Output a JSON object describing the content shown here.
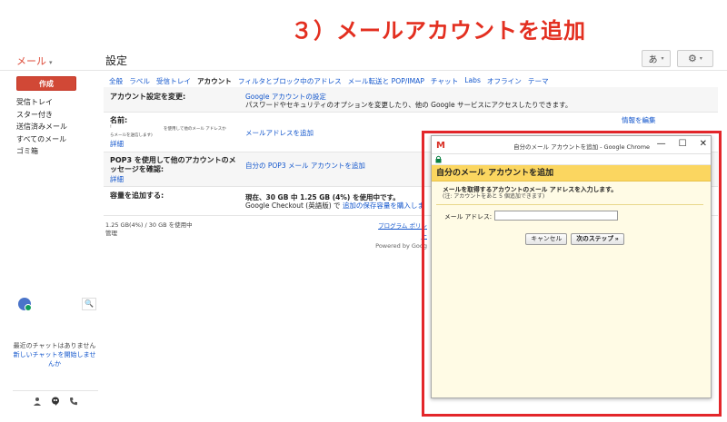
{
  "headline": "３）メールアカウントを追加",
  "topbar": {
    "mail_label": "メール",
    "mail_caret": "▾",
    "settings_title": "設定",
    "lang_button": "あ",
    "caret": "▾",
    "gear": "⚙"
  },
  "sidebar": {
    "compose": "作成",
    "items": [
      "受信トレイ",
      "スター付き",
      "送信済みメール",
      "すべてのメール",
      "ゴミ箱"
    ]
  },
  "tabs": [
    "全般",
    "ラベル",
    "受信トレイ",
    "アカウント",
    "フィルタとブロック中のアドレス",
    "メール転送と POP/IMAP",
    "チャット",
    "Labs",
    "オフライン",
    "テーマ"
  ],
  "settings": {
    "change_account": {
      "label": "アカウント設定を変更:",
      "link": "Google アカウントの設定",
      "desc": "パスワードやセキュリティのオプションを変更したり、他の Google サービスにアクセスしたりできます。"
    },
    "name": {
      "label": "名前:",
      "edit_info": "情報を編集"
    },
    "send_as": {
      "small_text": "を使用して他のメール アドレスか",
      "small_text2": "らメールを送信します)",
      "small_bang": "!",
      "details": "詳細",
      "add_address": "メールアドレスを追加"
    },
    "pop3": {
      "label": "POP3 を使用して他のアカウントのメッセージを確認:",
      "details": "詳細",
      "add_pop3": "自分の POP3 メール アカウントを追加"
    },
    "storage": {
      "label": "容量を追加する:",
      "usage": "現在、30 GB 中 1.25 GB (4%) を使用中です。",
      "checkout": "Google Checkout (英語版) で",
      "buy_link": "追加の保存容量を購入しま"
    }
  },
  "footer": {
    "storage": "1.25 GB(4%) / 30 GB を使用中",
    "manage": "管理",
    "program": "プログラム ポリシー",
    "powered": "Powered by Goog"
  },
  "chat": {
    "search_icon": "🔍",
    "empty_line1": "最近のチャットはありません",
    "start_link": "新しいチャットを開始しませんか",
    "icons": [
      "person-icon",
      "hangouts-icon",
      "phone-icon"
    ]
  },
  "dialog": {
    "window_title": "自分のメール アカウントを追加 - Google Chrome",
    "minimize": "—",
    "maximize": "☐",
    "close": "✕",
    "header": "自分のメール アカウントを追加",
    "instruction": "メールを取得するアカウントのメール アドレスを入力します。",
    "note": "(注: アカウントをあと 5 個追加できます)",
    "email_label": "メール アドレス:",
    "email_value": "",
    "cancel": "キャンセル",
    "next": "次のステップ »"
  },
  "colors": {
    "accent_red": "#e32f20",
    "compose_red": "#d14836",
    "link_blue": "#1155cc",
    "dialog_header_yellow": "#fbd660",
    "highlight_border": "#e3262a"
  }
}
